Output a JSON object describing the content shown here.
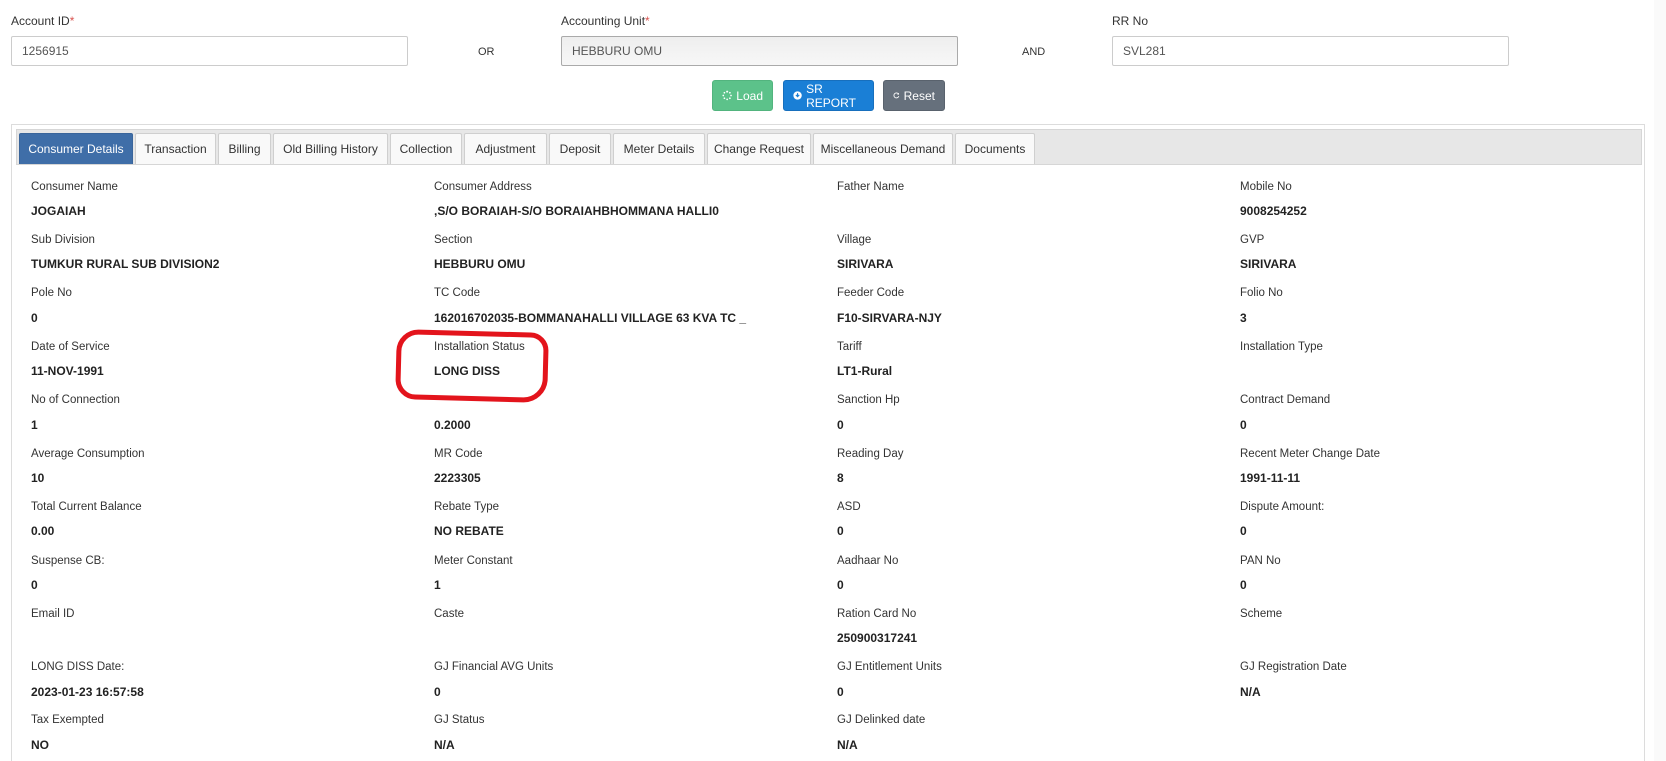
{
  "search": {
    "account_id_label": "Account ID",
    "account_id_value": "1256915",
    "or_label": "OR",
    "accounting_unit_label": "Accounting Unit",
    "accounting_unit_value": "HEBBURU OMU",
    "and_label": "AND",
    "rr_no_label": "RR No",
    "rr_no_value": "SVL281",
    "required_mark": "*"
  },
  "buttons": {
    "load": "Load",
    "sr_report": "SR REPORT",
    "reset": "Reset"
  },
  "tabs": [
    {
      "label": "Consumer Details",
      "active": true
    },
    {
      "label": "Transaction"
    },
    {
      "label": "Billing"
    },
    {
      "label": "Old Billing History"
    },
    {
      "label": "Collection"
    },
    {
      "label": "Adjustment"
    },
    {
      "label": "Deposit"
    },
    {
      "label": "Meter Details"
    },
    {
      "label": "Change Request"
    },
    {
      "label": "Miscellaneous Demand"
    },
    {
      "label": "Documents"
    }
  ],
  "details": {
    "consumer_name": {
      "label": "Consumer Name",
      "value": "JOGAIAH"
    },
    "consumer_address": {
      "label": "Consumer Address",
      "value": ",S/O BORAIAH-S/O BORAIAHBHOMMANA HALLI0"
    },
    "father_name": {
      "label": "Father Name",
      "value": ""
    },
    "mobile_no": {
      "label": "Mobile No",
      "value": "9008254252"
    },
    "sub_division": {
      "label": "Sub Division",
      "value": "TUMKUR RURAL SUB DIVISION2"
    },
    "section": {
      "label": "Section",
      "value": "HEBBURU OMU"
    },
    "village": {
      "label": "Village",
      "value": "SIRIVARA"
    },
    "gvp": {
      "label": "GVP",
      "value": "SIRIVARA"
    },
    "pole_no": {
      "label": "Pole No",
      "value": "0"
    },
    "tc_code": {
      "label": "TC Code",
      "value": "162016702035-BOMMANAHALLI VILLAGE 63 KVA TC _"
    },
    "feeder_code": {
      "label": "Feeder Code",
      "value": "F10-SIRVARA-NJY"
    },
    "folio_no": {
      "label": "Folio No",
      "value": "3"
    },
    "date_of_service": {
      "label": "Date of Service",
      "value": "11-NOV-1991"
    },
    "installation_status": {
      "label": "Installation Status",
      "value": "LONG DISS"
    },
    "tariff": {
      "label": "Tariff",
      "value": "LT1-Rural"
    },
    "installation_type": {
      "label": "Installation Type",
      "value": ""
    },
    "no_of_connection": {
      "label": "No of Connection",
      "value": "1"
    },
    "sanction_kw": {
      "label": "",
      "value": "0.2000"
    },
    "sanction_hp": {
      "label": "Sanction Hp",
      "value": "0"
    },
    "contract_demand": {
      "label": "Contract Demand",
      "value": "0"
    },
    "average_consumption": {
      "label": "Average Consumption",
      "value": "10"
    },
    "mr_code": {
      "label": "MR Code",
      "value": "2223305"
    },
    "reading_day": {
      "label": "Reading Day",
      "value": "8"
    },
    "recent_meter_change_date": {
      "label": "Recent Meter Change Date",
      "value": "1991-11-11"
    },
    "total_current_balance": {
      "label": "Total Current Balance",
      "value": "0.00"
    },
    "rebate_type": {
      "label": "Rebate Type",
      "value": "NO REBATE"
    },
    "asd": {
      "label": "ASD",
      "value": "0"
    },
    "dispute_amount": {
      "label": "Dispute Amount:",
      "value": "0"
    },
    "suspense_cb": {
      "label": "Suspense CB:",
      "value": "0"
    },
    "meter_constant": {
      "label": "Meter Constant",
      "value": "1"
    },
    "aadhaar_no": {
      "label": "Aadhaar No",
      "value": "0"
    },
    "pan_no": {
      "label": "PAN No",
      "value": "0"
    },
    "email_id": {
      "label": "Email ID",
      "value": ""
    },
    "caste": {
      "label": "Caste",
      "value": ""
    },
    "ration_card_no": {
      "label": "Ration Card No",
      "value": "250900317241"
    },
    "scheme": {
      "label": "Scheme",
      "value": ""
    },
    "long_diss_date": {
      "label": "LONG DISS Date:",
      "value": "2023-01-23 16:57:58"
    },
    "gj_financial_avg_units": {
      "label": "GJ Financial AVG Units",
      "value": "0"
    },
    "gj_entitlement_units": {
      "label": "GJ Entitlement Units",
      "value": "0"
    },
    "gj_registration_date": {
      "label": "GJ Registration Date",
      "value": "N/A"
    },
    "tax_exempted": {
      "label": "Tax Exempted",
      "value": "NO"
    },
    "gj_status": {
      "label": "GJ Status",
      "value": "N/A"
    },
    "gj_delinked_date": {
      "label": "GJ Delinked date",
      "value": "N/A"
    }
  },
  "colors": {
    "active_tab": "#3f6ea8",
    "load_button": "#5cc28a",
    "sr_button": "#1a7fd6",
    "reset_button": "#66707c",
    "annotation_ring": "#e3141c"
  }
}
